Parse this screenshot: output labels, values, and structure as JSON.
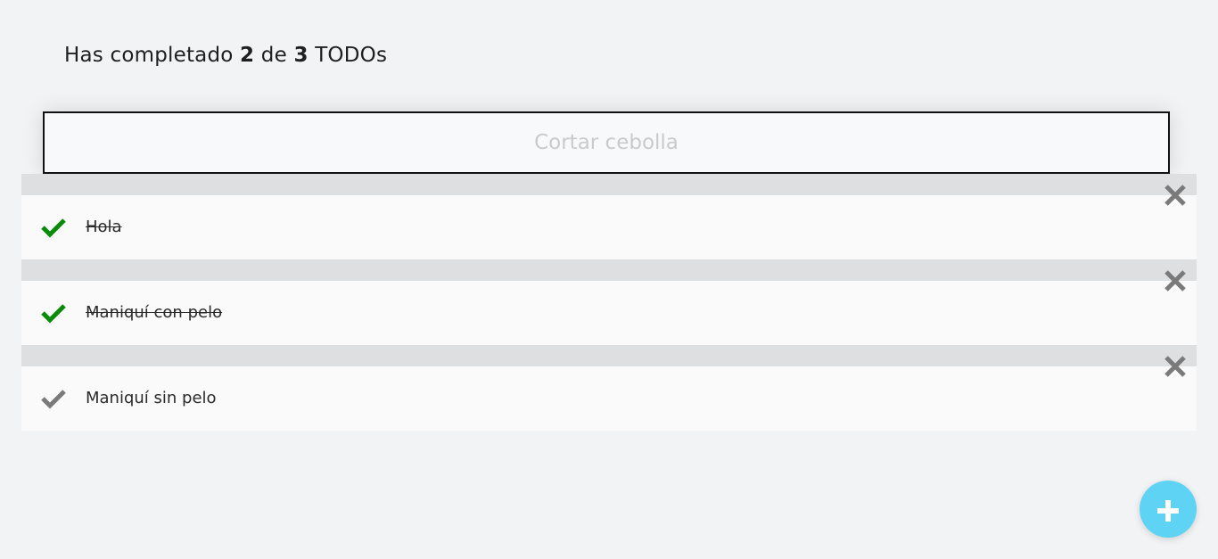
{
  "summary": {
    "prefix": "Has completado",
    "completed": "2",
    "middle": "de",
    "total": "3",
    "suffix": "TODOs"
  },
  "new_todo": {
    "placeholder": "Cortar cebolla",
    "value": ""
  },
  "todos": [
    {
      "text": "Hola",
      "done": true
    },
    {
      "text": "Maniquí con pelo",
      "done": true
    },
    {
      "text": "Maniquí sin pelo",
      "done": false
    }
  ],
  "icons": {
    "check_done": "check-icon",
    "check_pending": "check-icon",
    "delete": "close-icon",
    "add": "plus-icon"
  },
  "colors": {
    "check_done": "#0a8a0a",
    "check_pending": "#7a7a7a",
    "delete": "#7a7a7a",
    "fab": "#5fd3f3"
  }
}
